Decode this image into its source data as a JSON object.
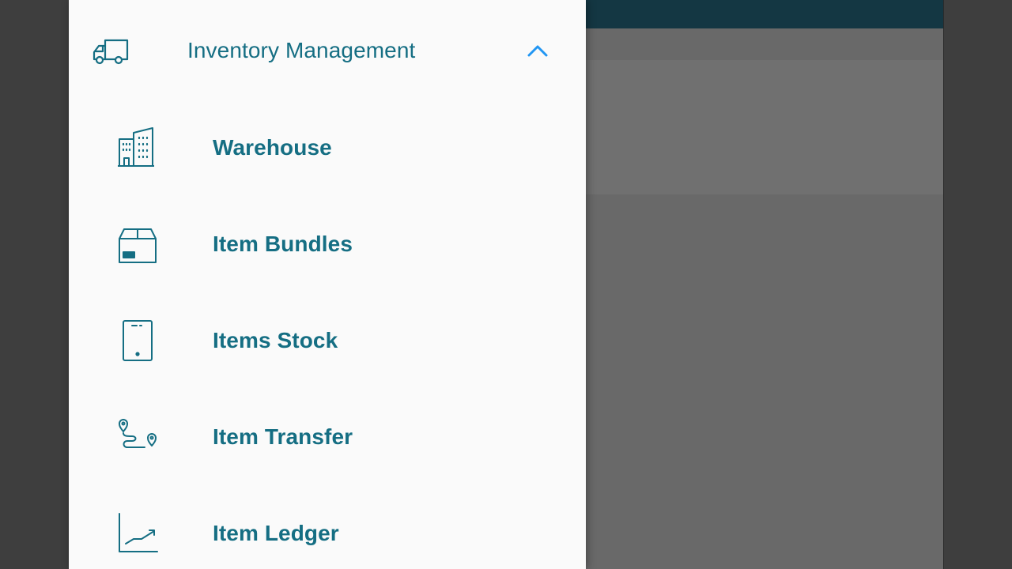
{
  "colors": {
    "accent": "#156e83",
    "chevron": "#2196f3",
    "drawer_bg": "#fafafa",
    "app_header": "#2e7d98"
  },
  "drawer": {
    "section": {
      "label": "Inventory Management",
      "icon": "truck-icon",
      "expanded": true
    },
    "items": [
      {
        "label": "Warehouse",
        "icon": "buildings-icon"
      },
      {
        "label": "Item Bundles",
        "icon": "box-icon"
      },
      {
        "label": "Items Stock",
        "icon": "tablet-icon"
      },
      {
        "label": "Item Transfer",
        "icon": "route-icon"
      },
      {
        "label": "Item Ledger",
        "icon": "chart-trend-icon"
      }
    ]
  }
}
